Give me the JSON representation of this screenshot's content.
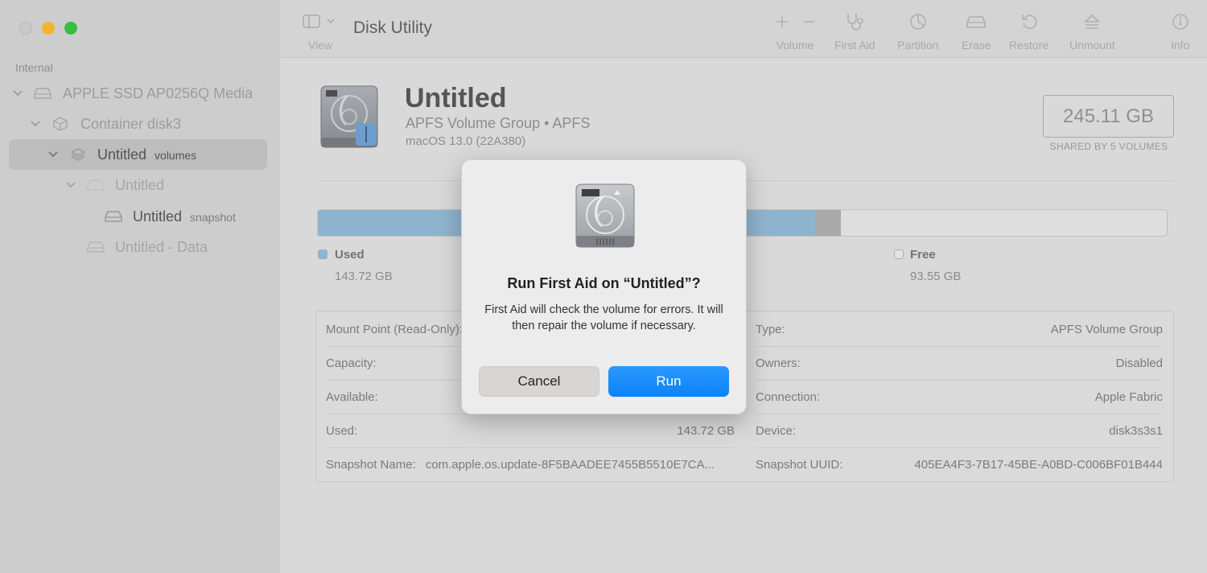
{
  "app": {
    "title": "Disk Utility"
  },
  "sidebar": {
    "section": "Internal",
    "items": [
      {
        "label": "APPLE SSD AP0256Q Media",
        "sub": ""
      },
      {
        "label": "Container disk3",
        "sub": ""
      },
      {
        "label": "Untitled",
        "sub": "volumes"
      },
      {
        "label": "Untitled",
        "sub": ""
      },
      {
        "label": "Untitled",
        "sub": "snapshot"
      },
      {
        "label": "Untitled - Data",
        "sub": ""
      }
    ]
  },
  "toolbar": {
    "view": "View",
    "volume": "Volume",
    "first_aid": "First Aid",
    "partition": "Partition",
    "erase": "Erase",
    "restore": "Restore",
    "unmount": "Unmount",
    "info": "Info"
  },
  "volume": {
    "name": "Untitled",
    "type": "APFS Volume Group • APFS",
    "os": "macOS 13.0 (22A380)",
    "size": "245.11 GB",
    "shared": "SHARED BY 5 VOLUMES"
  },
  "usage": {
    "used_fraction": 0.586,
    "other_fraction": 0.03,
    "used_label": "Used",
    "used_value": "143.72 GB",
    "free_label": "Free",
    "free_value": "93.55 GB",
    "used_color": "#8fb4cf"
  },
  "info": {
    "left": [
      {
        "k": "Mount Point (Read-Only):",
        "v": ""
      },
      {
        "k": "Capacity:",
        "v": ""
      },
      {
        "k": "Available:",
        "v": ""
      },
      {
        "k": "Used:",
        "v": "143.72 GB"
      },
      {
        "k": "Snapshot Name:",
        "v": "com.apple.os.update-8F5BAADEE7455B5510E7CA..."
      }
    ],
    "right": [
      {
        "k": "Type:",
        "v": "APFS Volume Group"
      },
      {
        "k": "Owners:",
        "v": "Disabled"
      },
      {
        "k": "Connection:",
        "v": "Apple Fabric"
      },
      {
        "k": "Device:",
        "v": "disk3s3s1"
      },
      {
        "k": "Snapshot UUID:",
        "v": "405EA4F3-7B17-45BE-A0BD-C006BF01B444"
      }
    ]
  },
  "dialog": {
    "title": "Run First Aid on “Untitled”?",
    "message": "First Aid will check the volume for errors. It will then repair the volume if necessary.",
    "cancel": "Cancel",
    "run": "Run",
    "run_color": "#0c82f7"
  }
}
